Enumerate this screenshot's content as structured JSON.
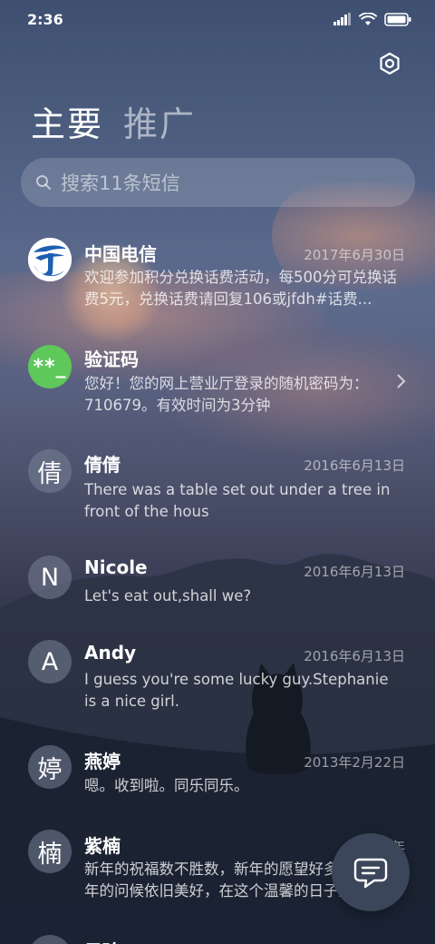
{
  "status_bar": {
    "time": "2:36"
  },
  "settings": {
    "icon": "gear-icon"
  },
  "tabs": [
    {
      "label": "主要",
      "active": true
    },
    {
      "label": "推广",
      "active": false
    }
  ],
  "search": {
    "placeholder": "搜索11条短信",
    "icon": "search-icon"
  },
  "conversations": [
    {
      "avatar": "",
      "avatar_type": "logo",
      "name": "中国电信",
      "date": "2017年6月30日",
      "preview": "欢迎参加积分兑换话费活动，每500分可兑换话费5元，兑换话费请回复106或jfdh#话费..."
    },
    {
      "avatar": "**_",
      "avatar_type": "green",
      "name": "验证码",
      "date": "",
      "preview": "您好！您的网上营业厅登录的随机密码为：710679。有效时间为3分钟"
    },
    {
      "avatar": "倩",
      "avatar_type": "gray",
      "name": "倩倩",
      "date": "2016年6月13日",
      "preview": "There was a table set out under a tree in front of the hous"
    },
    {
      "avatar": "N",
      "avatar_type": "gray",
      "name": "Nicole",
      "date": "2016年6月13日",
      "preview": "Let's eat out,shall we?"
    },
    {
      "avatar": "A",
      "avatar_type": "gray",
      "name": "Andy",
      "date": "2016年6月13日",
      "preview": "I guess you're some lucky guy.Stephanie is a nice girl."
    },
    {
      "avatar": "婷",
      "avatar_type": "gray",
      "name": "燕婷",
      "date": "2013年2月22日",
      "preview": "嗯。收到啦。同乐同乐。"
    },
    {
      "avatar": "楠",
      "avatar_type": "gray",
      "name": "紫楠",
      "date": "2013年",
      "preview": "新年的祝福数不胜数，新年的愿望好多好多，新年的问候依旧美好，在这个温馨的日子里"
    },
    {
      "avatar": "",
      "avatar_type": "gray",
      "name": "子玲",
      "date": "",
      "preview": ""
    }
  ],
  "compose": {
    "icon": "message-compose-icon"
  }
}
